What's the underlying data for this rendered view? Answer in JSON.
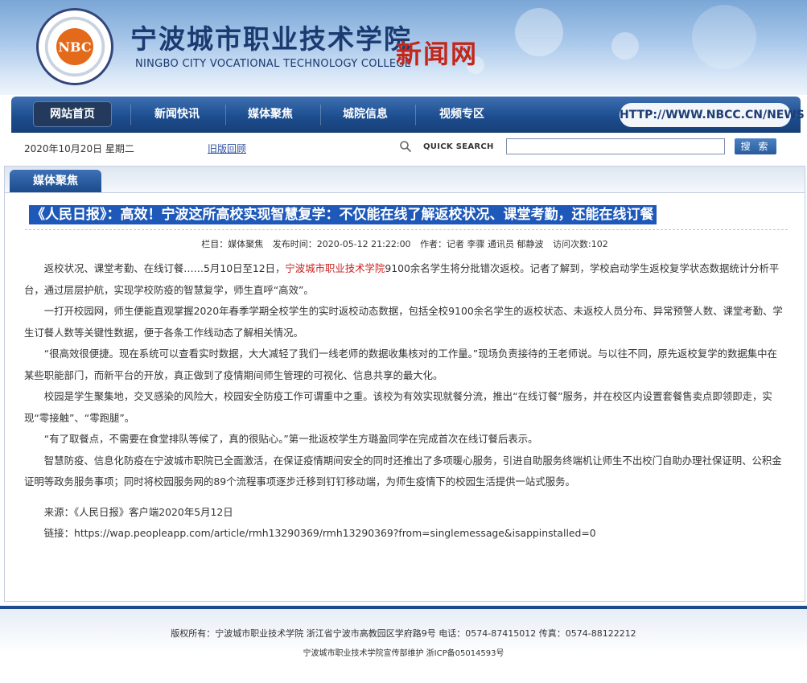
{
  "header": {
    "logo_text": "NBC",
    "school_name_cn": "宁波城市职业技术学院",
    "school_name_en": "NINGBO CITY VOCATIONAL TECHNOLOGY COLLEGE",
    "site_name": "新闻网"
  },
  "nav": {
    "items": [
      {
        "label": "网站首页",
        "active": true
      },
      {
        "label": "新闻快讯"
      },
      {
        "label": "媒体聚焦"
      },
      {
        "label": "城院信息"
      },
      {
        "label": "视频专区"
      }
    ],
    "url": "HTTP://WWW.NBCC.CN/NEWS"
  },
  "toolbar": {
    "date": "2020年10月20日  星期二",
    "old_version_link": "旧版回顾",
    "search_label": "QUICK SEARCH",
    "search_value": "",
    "search_button": "搜 索"
  },
  "section": {
    "tab": "媒体聚焦"
  },
  "article": {
    "title": "《人民日报》：高效！宁波这所高校实现智慧复学：不仅能在线了解返校状况、课堂考勤，还能在线订餐",
    "meta": {
      "column": "栏目：媒体聚焦",
      "time": "发布时间：2020-05-12 21:22:00",
      "author": "作者：记者 李骤 通讯员 郁静波",
      "views": "访问次数:102"
    },
    "p1_before": "返校状况、课堂考勤、在线订餐……5月10日至12日，",
    "p1_highlight": "宁波城市职业技术学院",
    "p1_after": "9100余名学生将分批错次返校。记者了解到，学校启动学生返校复学状态数据统计分析平台，通过层层护航，实现学校防疫的智慧复学，师生直呼“高效”。",
    "paragraphs": [
      "一打开校园网，师生便能直观掌握2020年春季学期全校学生的实时返校动态数据，包括全校9100余名学生的返校状态、未返校人员分布、异常预警人数、课堂考勤、学生订餐人数等关键性数据，便于各条工作线动态了解相关情况。",
      "“很高效很便捷。现在系统可以查看实时数据，大大减轻了我们一线老师的数据收集核对的工作量。”现场负责接待的王老师说。与以往不同，原先返校复学的数据集中在某些职能部门，而新平台的开放，真正做到了疫情期间师生管理的可视化、信息共享的最大化。",
      "校园是学生聚集地，交叉感染的风险大，校园安全防疫工作可谓重中之重。该校为有效实现就餐分流，推出“在线订餐”服务，并在校区内设置套餐售卖点即领即走，实现“零接触”、“零跑腿”。",
      "“有了取餐点，不需要在食堂排队等候了，真的很贴心。”第一批返校学生方璐盈同学在完成首次在线订餐后表示。",
      "智慧防疫、信息化防疫在宁波城市职院已全面激活，在保证疫情期间安全的同时还推出了多项暖心服务，引进自助服务终端机让师生不出校门自助办理社保证明、公积金证明等政务服务事项；同时将校园服务网的89个流程事项逐步迁移到钉钉移动端，为师生疫情下的校园生活提供一站式服务。"
    ],
    "source": "来源：《人民日报》客户端2020年5月12日",
    "link": "链接：https://wap.peopleapp.com/article/rmh13290369/rmh13290369?from=singlemessage&isappinstalled=0"
  },
  "footer": {
    "line1": "版权所有：宁波城市职业技术学院 浙江省宁波市高教园区学府路9号 电话：0574-87415012 传真：0574-88122212",
    "line2": "宁波城市职业技术学院宣传部维护 浙ICP备05014593号"
  },
  "colors": {
    "nav_blue": "#1d4e90",
    "title_highlight": "#1e59b9",
    "link_red": "#c8231f"
  }
}
